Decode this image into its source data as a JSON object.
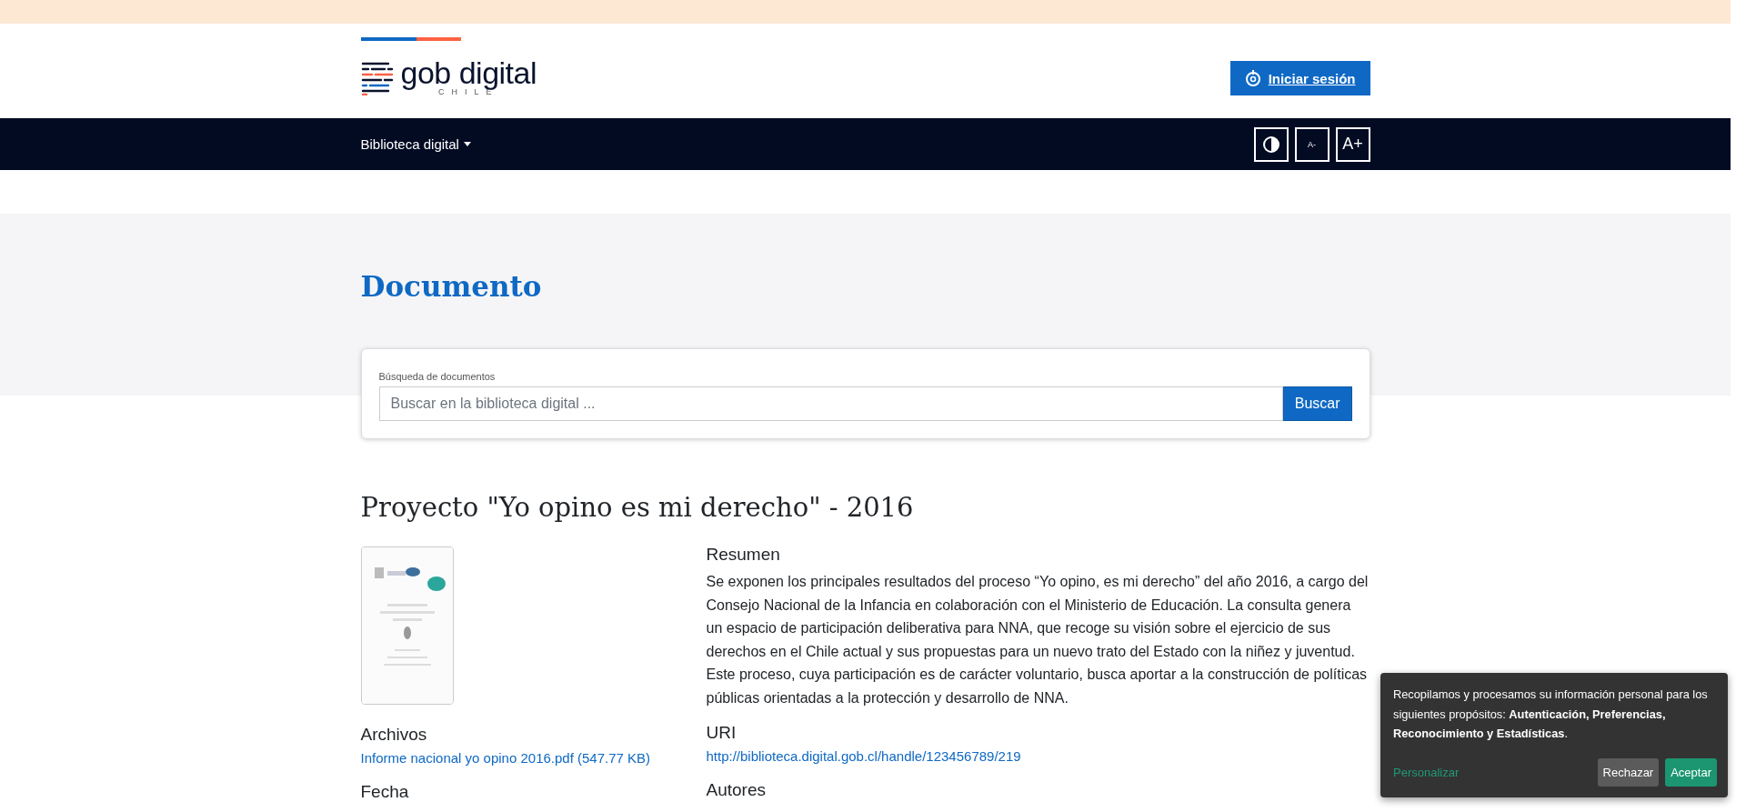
{
  "header": {
    "logo": {
      "name": "gob digital",
      "subtitle": "CHILE"
    },
    "login_button": "Iniciar sesión"
  },
  "nav": {
    "menu": "Biblioteca digital",
    "tools": [
      {
        "kind": "contrast"
      },
      {
        "kind": "smaller",
        "label": "A-"
      },
      {
        "kind": "larger",
        "label": "A+"
      }
    ]
  },
  "hero": {
    "title": "Documento"
  },
  "search": {
    "label": "Búsqueda de documentos",
    "placeholder": "Buscar en la biblioteca digital ...",
    "button": "Buscar"
  },
  "document": {
    "title": "Proyecto \"Yo opino es mi derecho\" - 2016",
    "files": {
      "heading": "Archivos",
      "links": [
        "Informe nacional yo opino 2016.pdf (547.77 KB)"
      ]
    },
    "date": {
      "heading": "Fecha"
    },
    "abstract": {
      "heading": "Resumen",
      "text": "Se exponen los principales resultados del proceso “Yo opino, es mi derecho” del año 2016, a cargo del Consejo Nacional de la Infancia en colaboración con el Ministerio de Educación. La consulta genera un espacio de participación deliberativa para NNA, que recoge su visión sobre el ejercicio de sus derechos en el Chile actual y sus propuestas para un nuevo trato del Estado con la niñez y juventud. Este proceso, cuya participación es de carácter voluntario, busca aportar a la construcción de políticas públicas orientadas a la protección y desarrollo de NNA."
    },
    "uri": {
      "heading": "URI",
      "link": "http://biblioteca.digital.gob.cl/handle/123456789/219"
    },
    "authors": {
      "heading": "Autores"
    }
  },
  "cookie_banner": {
    "text": "Recopilamos y procesamos su información personal para los siguientes propósitos: **Autenticación, Preferencias, Reconocimiento y Estadísticas**.",
    "customize": "Personalizar",
    "buttons": [
      {
        "kind": "reject",
        "label": "Rechazar"
      },
      {
        "kind": "accept",
        "label": "Aceptar"
      }
    ]
  }
}
